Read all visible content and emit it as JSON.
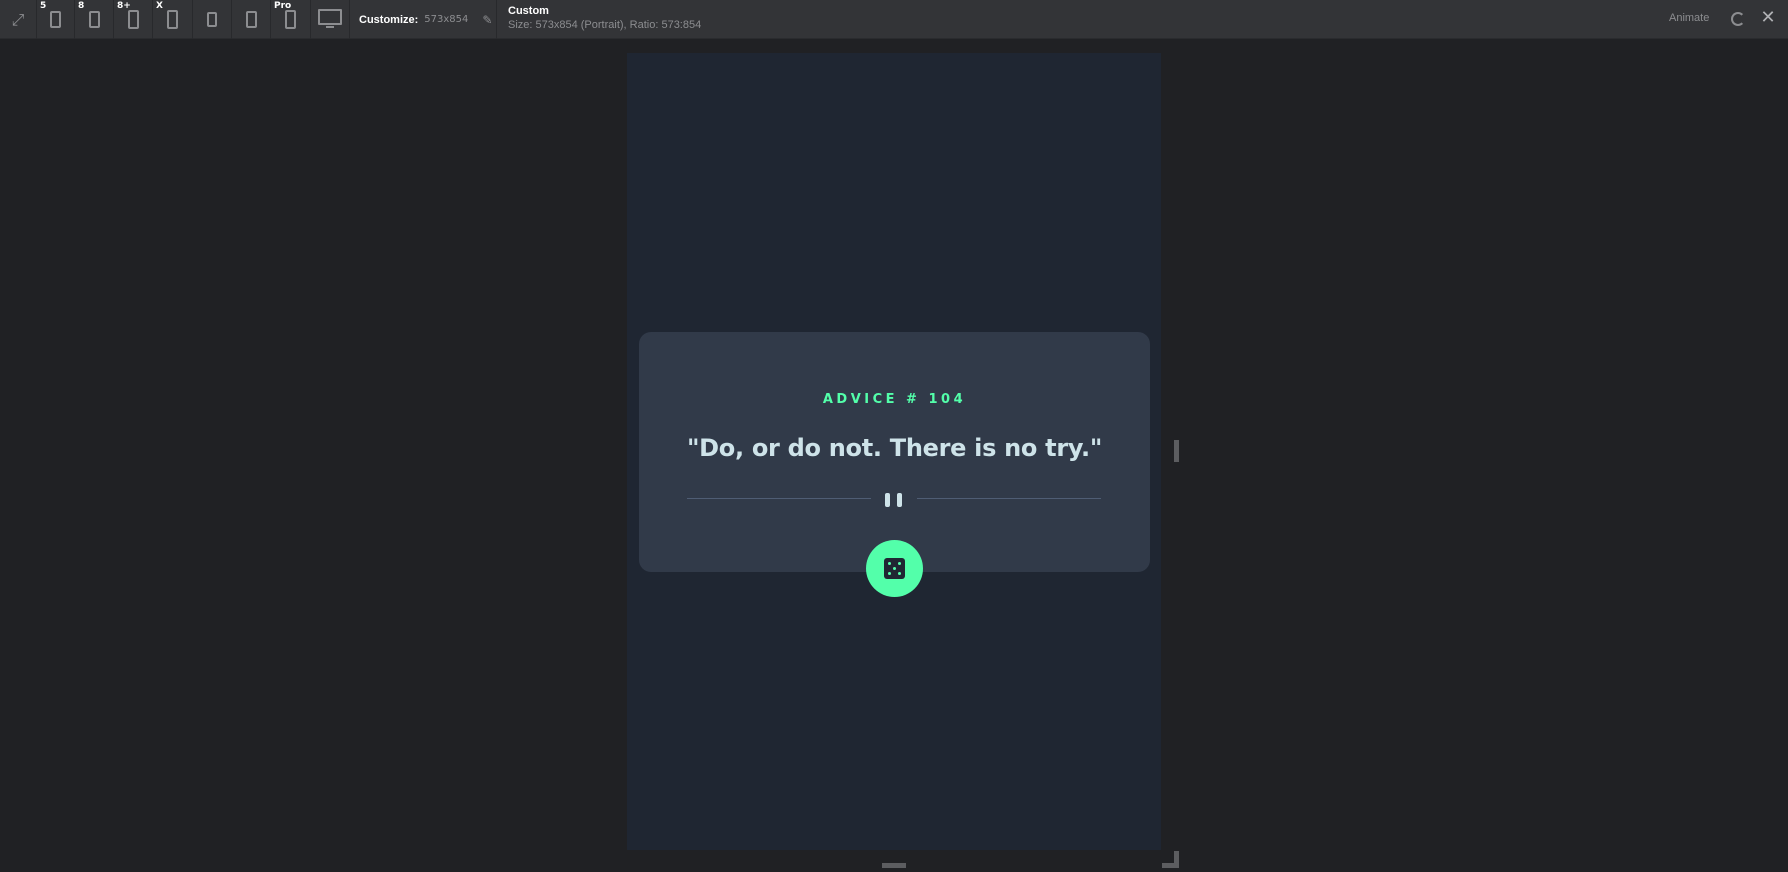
{
  "toolbar": {
    "devices": [
      {
        "name": "fit-screen",
        "badge": ""
      },
      {
        "name": "iphone-5",
        "badge": "5"
      },
      {
        "name": "iphone-8",
        "badge": "8"
      },
      {
        "name": "iphone-8-plus",
        "badge": "8+"
      },
      {
        "name": "iphone-x",
        "badge": "X"
      },
      {
        "name": "ipad-mini",
        "badge": ""
      },
      {
        "name": "ipad",
        "badge": ""
      },
      {
        "name": "ipad-pro",
        "badge": "Pro"
      },
      {
        "name": "desktop",
        "badge": ""
      }
    ],
    "customize_label": "Customize:",
    "customize_value": "573x854",
    "preset_name": "Custom",
    "preset_desc": "Size: 573x854 (Portrait), Ratio: 573:854",
    "animate_label": "Animate"
  },
  "advice_card": {
    "advice_id": "ADVICE # 104",
    "quote": "\"Do, or do not. There is no try.\""
  },
  "colors": {
    "accent": "#53ffaa",
    "card_bg": "#313a49",
    "page_bg": "#1f2632",
    "text_light": "#cee3e9",
    "app_bg": "#202124",
    "toolbar_bg": "#333437"
  },
  "icons": [
    "expand-icon",
    "phone-icon",
    "tablet-icon",
    "monitor-icon",
    "pencil-icon",
    "refresh-icon",
    "close-icon",
    "pause-icon",
    "dice-icon"
  ]
}
